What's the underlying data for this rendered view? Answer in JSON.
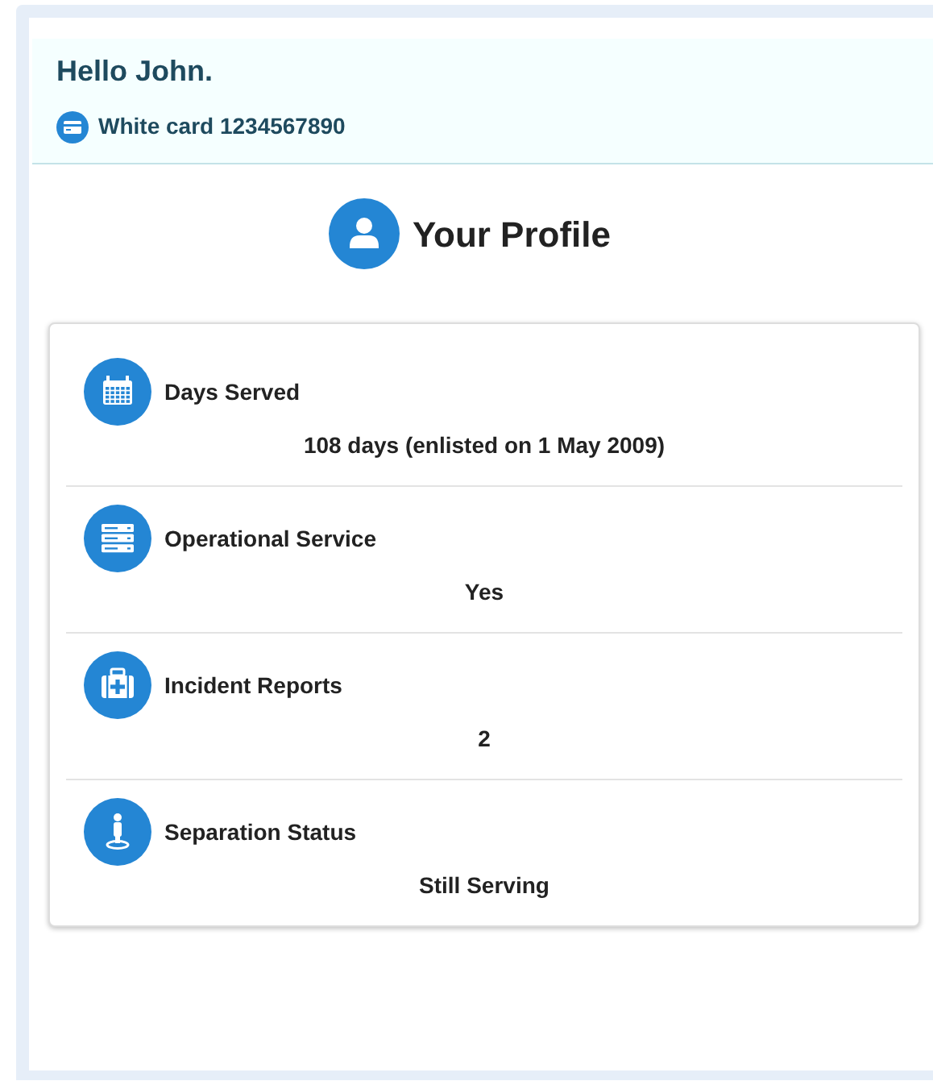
{
  "greeting": "Hello John.",
  "card": {
    "label": "White card 1234567890"
  },
  "title": "Your Profile",
  "items": [
    {
      "kind": "calendar",
      "label": "Days Served",
      "value": "108 days (enlisted on 1 May 2009)"
    },
    {
      "kind": "server",
      "label": "Operational Service",
      "value": "Yes"
    },
    {
      "kind": "medkit",
      "label": "Incident Reports",
      "value": "2"
    },
    {
      "kind": "person",
      "label": "Separation Status",
      "value": "Still Serving"
    }
  ]
}
